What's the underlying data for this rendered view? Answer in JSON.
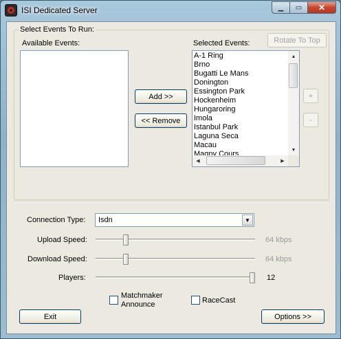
{
  "window": {
    "title": "ISI Dedicated Server"
  },
  "caption": {
    "minimize": "▁",
    "maximize": "▭",
    "close": "✕"
  },
  "events_group": {
    "title": "Select Events To Run:",
    "available_label": "Available Events:",
    "selected_label": "Selected Events:",
    "available_items": [],
    "selected_items": [
      "A-1 Ring",
      "Brno",
      "Bugatti Le Mans",
      "Donington",
      "Essington Park",
      "Hockenheim",
      "Hungaroring",
      "Imola",
      "Istanbul Park",
      "Laguna Seca",
      "Macau",
      "Magny Cours"
    ],
    "add_button": "Add >>",
    "remove_button": "<< Remove",
    "rotate_button": "Rotate To Top",
    "plus_button": "+",
    "minus_button": "-"
  },
  "settings": {
    "connection_label": "Connection Type:",
    "connection_value": "Isdn",
    "upload_label": "Upload Speed:",
    "upload_value": "64 kbps",
    "upload_level": 0.18,
    "download_label": "Download Speed:",
    "download_value": "64 kbps",
    "download_level": 0.18,
    "players_label": "Players:",
    "players_value": "12",
    "players_level": 1.0,
    "matchmaker_label_line1": "Matchmaker",
    "matchmaker_label_line2": "Announce",
    "matchmaker_checked": false,
    "racecast_label": "RaceCast",
    "racecast_checked": false
  },
  "footer": {
    "exit_button": "Exit",
    "options_button": "Options >>"
  }
}
